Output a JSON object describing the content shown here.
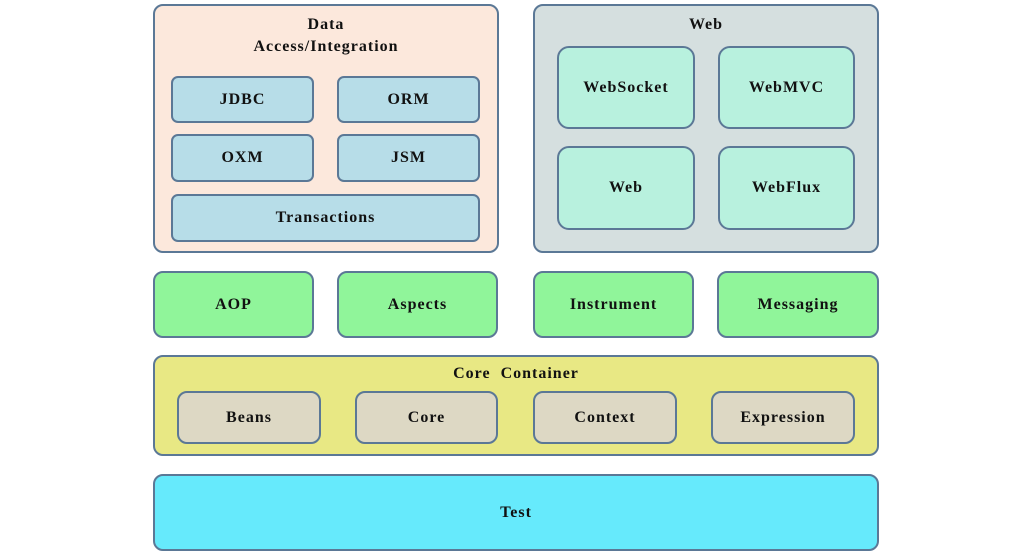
{
  "data_access": {
    "title_line1": "Data",
    "title_line2": "Access/Integration",
    "items": [
      "JDBC",
      "ORM",
      "OXM",
      "JSM",
      "Transactions"
    ]
  },
  "web": {
    "title": "Web",
    "items": [
      "WebSocket",
      "WebMVC",
      "Web",
      "WebFlux"
    ]
  },
  "middle": [
    "AOP",
    "Aspects",
    "Instrument",
    "Messaging"
  ],
  "core_container": {
    "title": "Core  Container",
    "items": [
      "Beans",
      "Core",
      "Context",
      "Expression"
    ]
  },
  "test": "Test",
  "colors": {
    "data_bg": "#fce8dc",
    "data_inner": "#b7dde8",
    "web_bg": "#d5dfdf",
    "web_inner": "#b8f1de",
    "green": "#90f59a",
    "core_bg": "#e8e884",
    "core_inner": "#ddd8c4",
    "test": "#66eafc",
    "border": "#5b7896"
  }
}
